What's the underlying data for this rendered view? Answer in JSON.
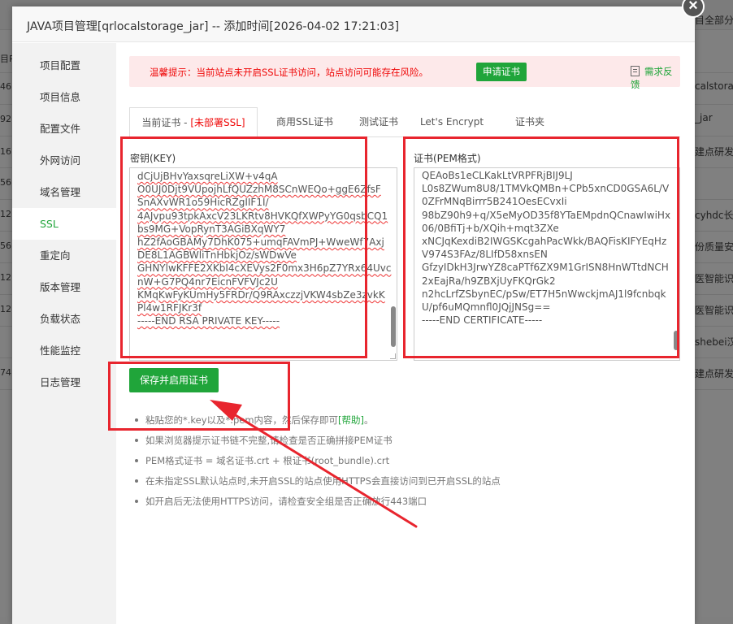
{
  "background": {
    "right_texts": [
      "目全部分类",
      "calstorage",
      "_jar",
      "建点研发设",
      "cyhdc长安",
      "份质量安全",
      "医智能识别",
      "医智能识别",
      "shebei汉",
      "建点研发设"
    ],
    "left_texts": [
      "目P",
      "46",
      "92",
      "16",
      "56",
      "12",
      "56",
      "12",
      "12",
      "74"
    ]
  },
  "modal": {
    "title": "JAVA项目管理[qrlocalstorage_jar] -- 添加时间[2026-04-02 17:21:03]",
    "close_label": "×"
  },
  "sidebar": {
    "items": [
      {
        "label": "项目配置"
      },
      {
        "label": "项目信息"
      },
      {
        "label": "配置文件"
      },
      {
        "label": "外网访问"
      },
      {
        "label": "域名管理"
      },
      {
        "label": "SSL"
      },
      {
        "label": "重定向"
      },
      {
        "label": "版本管理"
      },
      {
        "label": "负载状态"
      },
      {
        "label": "性能监控"
      },
      {
        "label": "日志管理"
      }
    ],
    "active_index": 5
  },
  "warning": {
    "text": "温馨提示：当前站点未开启SSL证书访问，站点访问可能存在风险。",
    "apply_button": "申请证书",
    "feedback": "需求反馈"
  },
  "tabs": [
    {
      "label": "当前证书 - ",
      "suffix": "[未部署SSL]"
    },
    {
      "label": "商用SSL证书"
    },
    {
      "label": "测试证书"
    },
    {
      "label": "Let's Encrypt"
    },
    {
      "label": "证书夹"
    }
  ],
  "key_field": {
    "label": "密钥(KEY)",
    "lines": [
      "dCjUjBHvYaxsqreLiXW+v4qA",
      "O0UJ0Djt9VUpojhLfQUZzhM8SCnWEQo+ggE6ZfsF",
      "SnAXvWR1o59HicRZgIIF1I/",
      "4AJvpu93tpkAxcV23LKRtv8HVKQfXWPyYG0qsbCQ1",
      "bs9MG+VopRynT3AGiBXqWY7",
      "hZ2fAoGBAMy7DhK075+umqFAVmPJ+WweWf7Axj",
      "DE8L1AGBWliTnHbkjOz/sWDwVe",
      "GHNYlwKFFE2XKbI4cXEVys2F0mx3H6pZ7YRx64Uvc",
      "nW+G7PQ4nr7EicnFVFVJc2U",
      "KMqKwFyKUmHy5FRDr/Q9RAxczzjVKW4sbZe3zvkK",
      "Pl4w1RFJKr3f",
      "-----END RSA PRIVATE KEY-----"
    ]
  },
  "cert_field": {
    "label": "证书(PEM格式)",
    "lines": [
      "QEAoBs1eCLKakLtVRPFRjBIJ9LJ",
      "L0s8ZWum8U8/1TMVkQMBn+CPb5xnCD0GSA6L/V",
      "0ZFrMNqBirrr5B241OesECvxIi",
      "98bZ90h9+q/X5eMyOD35f8YTaEMpdnQCnawIwiHx",
      "06/0BfiTj+b/XQih+mqt3ZXe",
      "xNCJqKexdiB2IWGSKcgahPacWkk/BAQFisKIFYEqHz",
      "V974S3FAz/8LIfD58xnsEN",
      "GfzyIDkH3JrwYZ8caPTf6ZX9M1GrISN8HnWTtdNCH",
      "2xEajRa/h9ZBXjUyFKQrGk2",
      "n2hcLrfZSbynEC/pSw/ET7H5nWwckjmAJ1l9fcnbqk",
      "U/pf6uMQmnfl0JQjJNSg==",
      "-----END CERTIFICATE-----"
    ]
  },
  "save_button": "保存并启用证书",
  "tips": [
    {
      "text": "粘贴您的*.key以及*.pem内容，然后保存即可",
      "link": "[帮助]",
      "tail": "。"
    },
    {
      "text": "如果浏览器提示证书链不完整,请检查是否正确拼接PEM证书"
    },
    {
      "text": "PEM格式证书 = 域名证书.crt + 根证书(root_bundle).crt"
    },
    {
      "text": "在未指定SSL默认站点时,未开启SSL的站点使用HTTPS会直接访问到已开启SSL的站点"
    },
    {
      "text": "如开启后无法使用HTTPS访问，请检查安全组是否正确放行443端口"
    }
  ],
  "colors": {
    "accent": "#20a53a",
    "warning_text": "#ef0808",
    "warning_bg": "#fde9ea",
    "annotation": "#e8252e"
  }
}
